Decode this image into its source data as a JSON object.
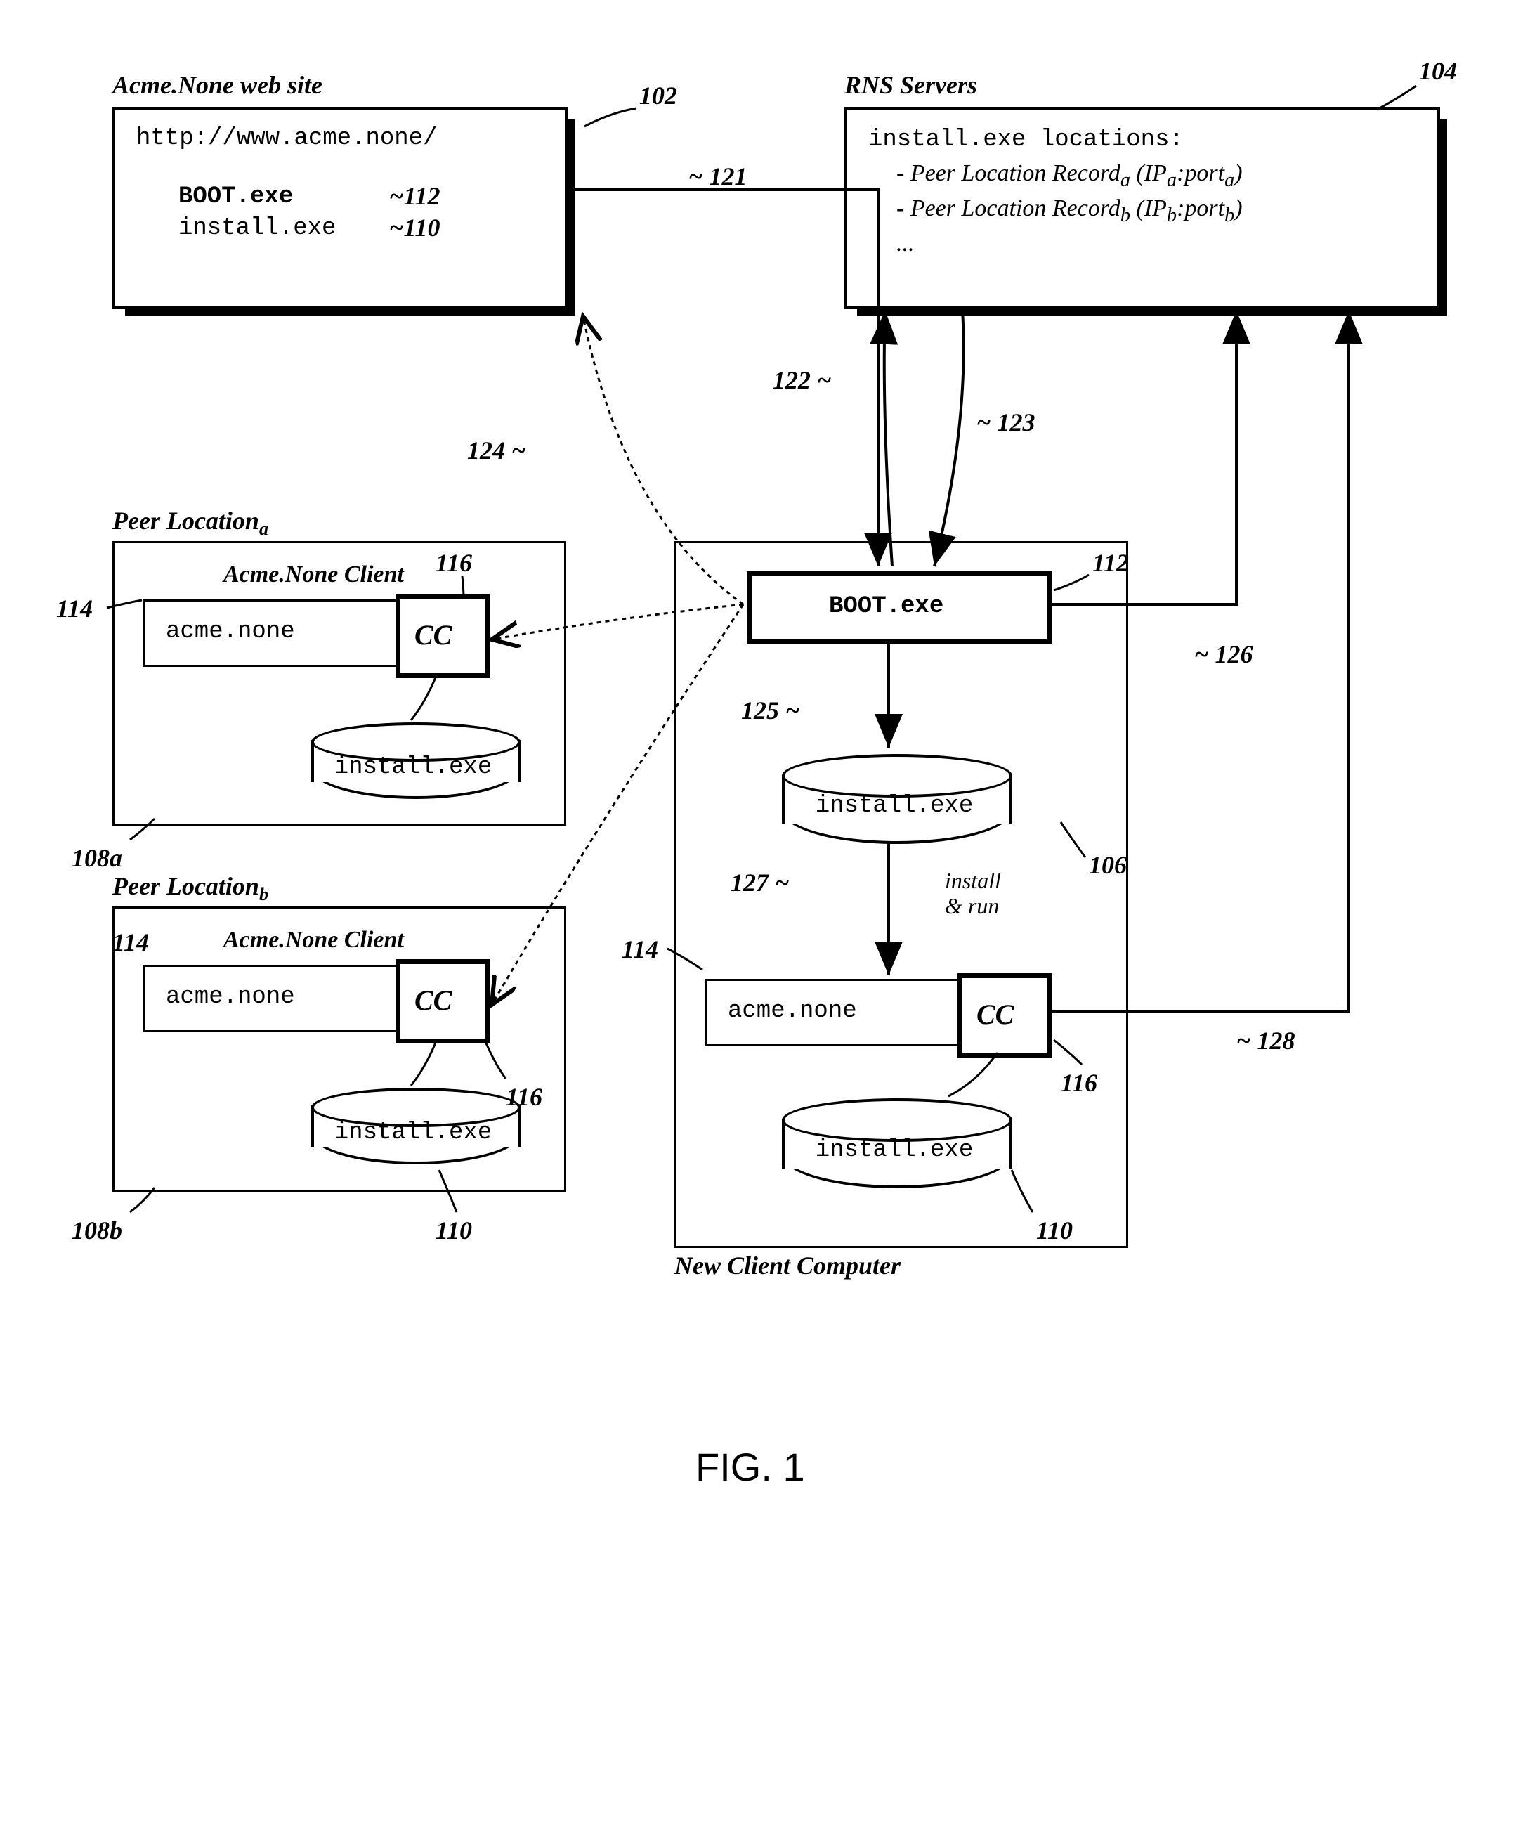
{
  "website": {
    "title": "Acme.None web site",
    "url": "http://www.acme.none/",
    "file1": "BOOT.exe",
    "file2": "install.exe",
    "ref1": "~112",
    "ref2": "~110",
    "boxref": "102"
  },
  "rns": {
    "title": "RNS Servers",
    "header": "install.exe locations:",
    "line1a": "- Peer Location Record",
    "line1b": " (IP",
    "line1c": ":port",
    "line1d": ")",
    "line2a": "- Peer Location Record",
    "line2b": " (IP",
    "line2c": ":port",
    "line2d": ")",
    "line3": "...",
    "boxref": "104"
  },
  "peerA": {
    "title": "Peer Location",
    "sub": "a",
    "client_title": "Acme.None Client",
    "acme": "acme.none",
    "cc": "CC",
    "cyl": "install.exe",
    "ref_box": "108a",
    "ref_client": "114",
    "ref_cc": "116"
  },
  "peerB": {
    "title": "Peer Location",
    "sub": "b",
    "client_title": "Acme.None Client",
    "acme": "acme.none",
    "cc": "CC",
    "cyl": "install.exe",
    "ref_box": "108b",
    "ref_client": "114",
    "ref_cc": "116",
    "ref_cyl": "110"
  },
  "newclient": {
    "title": "New Client Computer",
    "boot": "BOOT.exe",
    "cyl1": "install.exe",
    "install_run": "install\n& run",
    "acme": "acme.none",
    "cc": "CC",
    "cyl2": "install.exe",
    "ref_boot": "112",
    "ref_106": "106",
    "ref_114": "114",
    "ref_116": "116",
    "ref_110": "110"
  },
  "arrows": {
    "a121": "~ 121",
    "a122": "122 ~",
    "a123": "~ 123",
    "a124": "124 ~",
    "a125": "125 ~",
    "a126": "~ 126",
    "a127": "127 ~",
    "a128": "~ 128"
  },
  "figure": "FIG. 1"
}
